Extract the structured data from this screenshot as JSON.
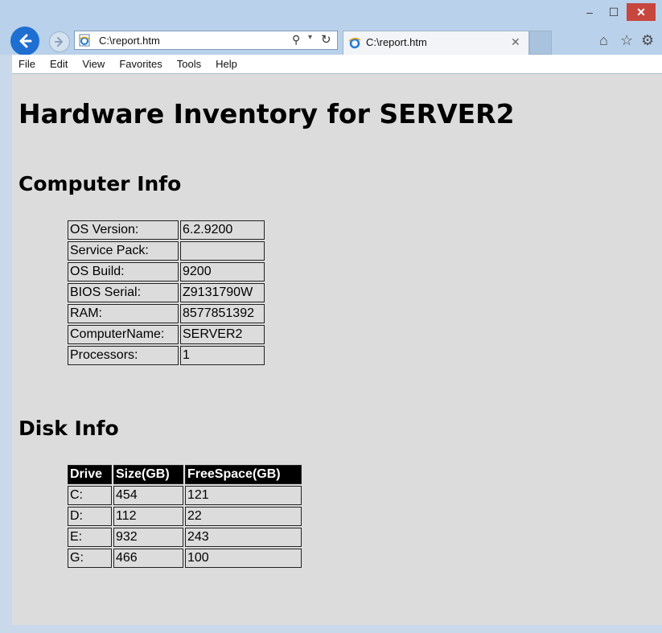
{
  "browser": {
    "address": "C:\\report.htm",
    "tab_title": "C:\\report.htm",
    "window_controls": {
      "minimize": "–",
      "maximize": "☐",
      "close": "✕"
    },
    "icons": [
      "back-arrow-icon",
      "forward-arrow-icon",
      "ie-page-icon",
      "search-icon",
      "refresh-icon",
      "home-icon",
      "favorites-star-icon",
      "gear-icon"
    ]
  },
  "menu": [
    "File",
    "Edit",
    "View",
    "Favorites",
    "Tools",
    "Help"
  ],
  "page": {
    "title": "Hardware Inventory for SERVER2",
    "computer_heading": "Computer Info",
    "computer_rows": [
      {
        "label": "OS Version:",
        "value": "6.2.9200"
      },
      {
        "label": "Service Pack:",
        "value": ""
      },
      {
        "label": "OS Build:",
        "value": "9200"
      },
      {
        "label": "BIOS Serial:",
        "value": "Z9131790W"
      },
      {
        "label": "RAM:",
        "value": "8577851392"
      },
      {
        "label": "ComputerName:",
        "value": "SERVER2"
      },
      {
        "label": "Processors:",
        "value": "1"
      }
    ],
    "disk_heading": "Disk Info",
    "disk_headers": [
      "Drive",
      "Size(GB)",
      "FreeSpace(GB)"
    ],
    "disk_rows": [
      [
        "C:",
        "454",
        "121"
      ],
      [
        "D:",
        "112",
        "22"
      ],
      [
        "E:",
        "932",
        "243"
      ],
      [
        "G:",
        "466",
        "100"
      ]
    ]
  },
  "colors": {
    "chrome": "#b9d1ea",
    "content_bg": "#dcdcdc",
    "back_button": "#1e6fd1",
    "close_button": "#c7463d"
  }
}
